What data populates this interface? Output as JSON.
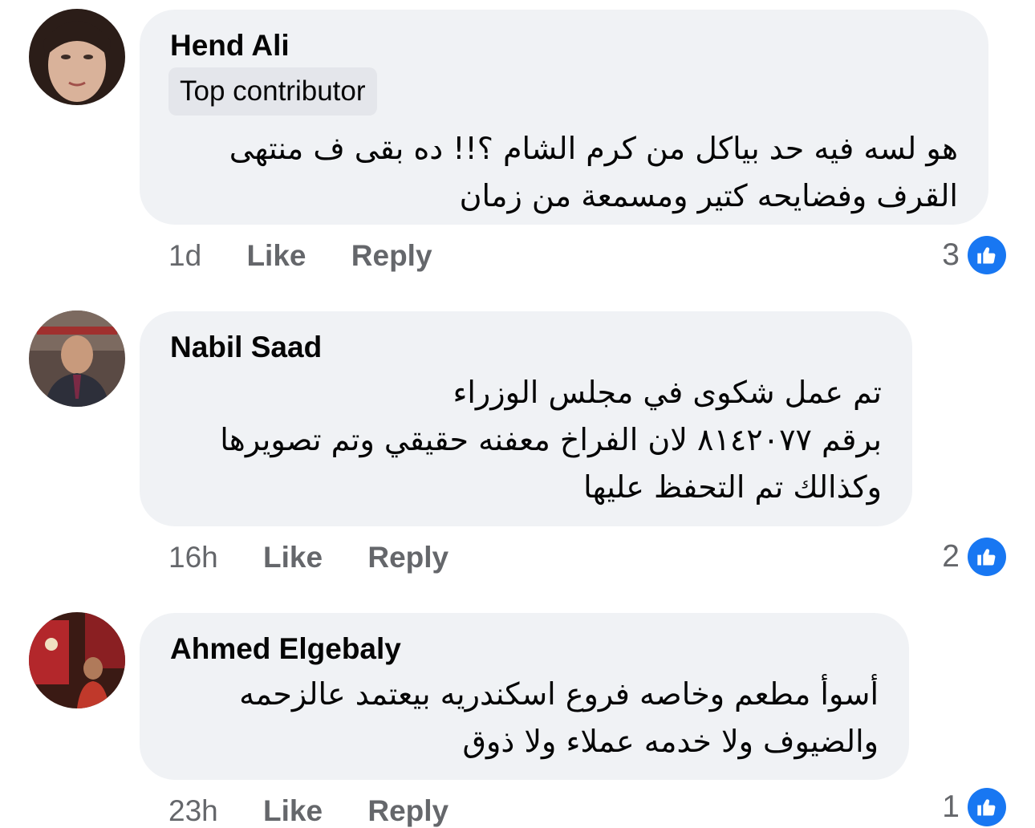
{
  "comments": [
    {
      "author": "Hend Ali",
      "badge": "Top contributor",
      "text_lines": [
        "هو لسه فيه حد بياكل من كرم الشام ؟!!  ده بقى ف منتهى",
        "القرف وفضايحه كتير ومسمعة من زمان"
      ],
      "time": "1d",
      "like_label": "Like",
      "reply_label": "Reply",
      "reaction_count": "3",
      "reaction_icon": "like-icon",
      "avatar_colors": [
        "#c9a38a",
        "#2b1d18"
      ]
    },
    {
      "author": "Nabil Saad",
      "text_lines": [
        "تم عمل شكوى في مجلس الوزراء",
        "برقم ٨١٤٢٠٧٧ لان الفراخ معفنه حقيقي وتم تصويرها",
        "وكذالك تم التحفظ عليها"
      ],
      "time": "16h",
      "like_label": "Like",
      "reply_label": "Reply",
      "reaction_count": "2",
      "reaction_icon": "like-icon",
      "avatar_colors": [
        "#6b5a4e",
        "#2d2f3a"
      ]
    },
    {
      "author": "Ahmed Elgebaly",
      "text_lines": [
        "أسوأ مطعم وخاصه فروع اسكندريه بيعتمد عالزحمه",
        "والضيوف ولا خدمه عملاء ولا ذوق"
      ],
      "time": "23h",
      "like_label": "Like",
      "reply_label": "Reply",
      "reaction_count": "1",
      "reaction_icon": "like-icon",
      "avatar_colors": [
        "#b3272b",
        "#3a1a14"
      ]
    }
  ],
  "colors": {
    "bubble": "#f0f2f5",
    "badge": "#e4e6eb",
    "meta_text": "#65676b",
    "like_blue": "#1877f2"
  }
}
